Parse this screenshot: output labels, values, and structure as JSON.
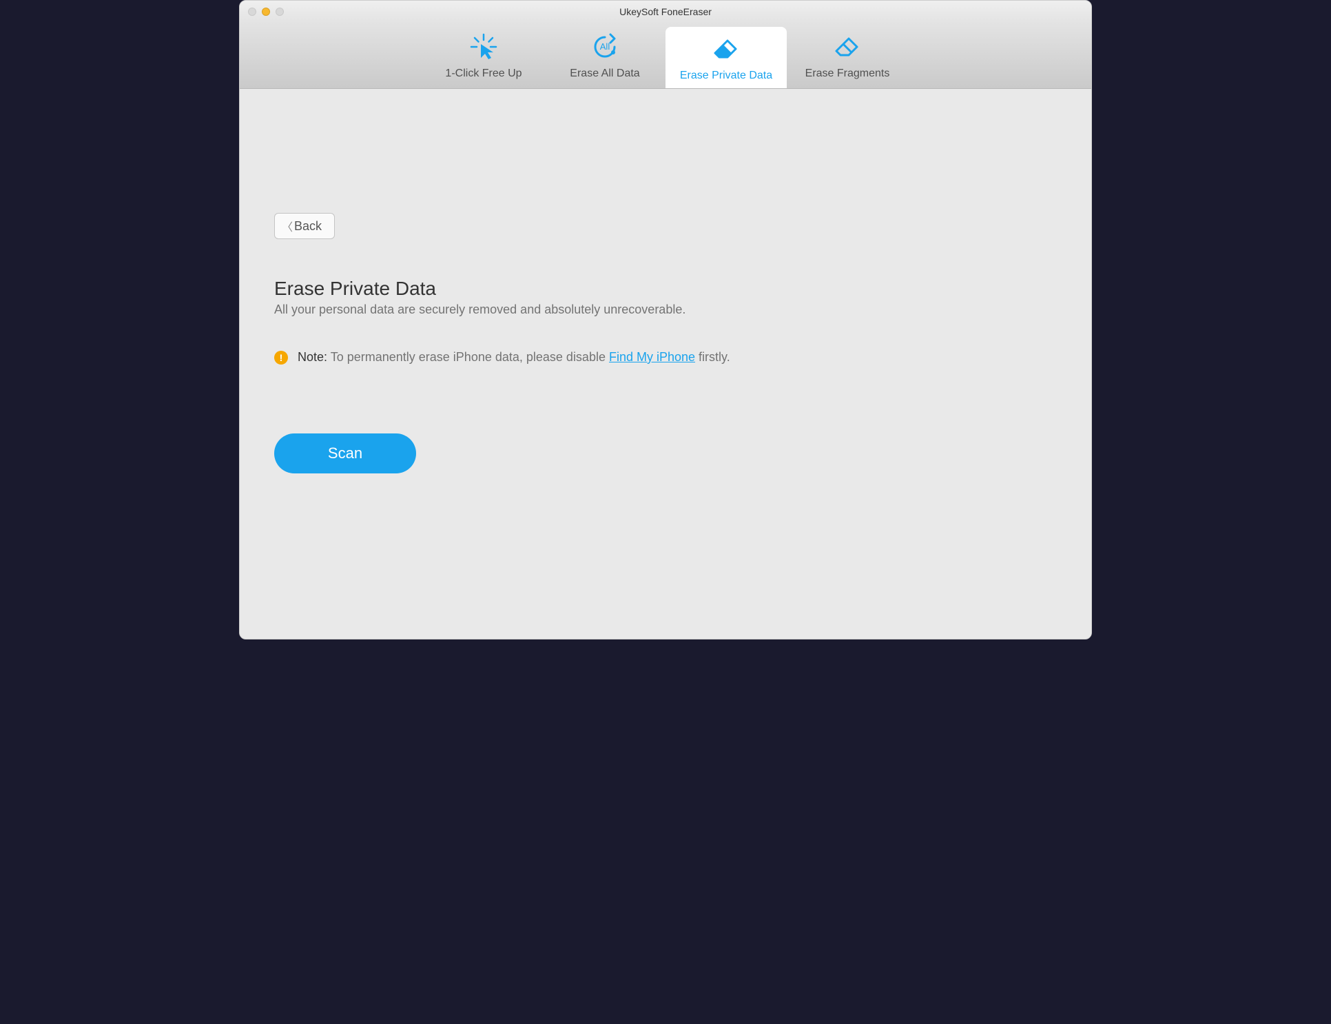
{
  "window": {
    "title": "UkeySoft FoneEraser"
  },
  "tabs": [
    {
      "label": "1-Click Free Up",
      "icon": "click-icon"
    },
    {
      "label": "Erase All Data",
      "icon": "erase-all-icon"
    },
    {
      "label": "Erase Private Data",
      "icon": "eraser-icon"
    },
    {
      "label": "Erase Fragments",
      "icon": "eraser-outline-icon"
    }
  ],
  "back": {
    "label": "Back"
  },
  "page": {
    "heading": "Erase Private Data",
    "subheading": "All your personal data are securely removed and absolutely unrecoverable."
  },
  "note": {
    "label": "Note:",
    "text_before": " To permanently erase iPhone data, please disable ",
    "link": "Find My iPhone",
    "text_after": " firstly."
  },
  "actions": {
    "scan_label": "Scan"
  }
}
